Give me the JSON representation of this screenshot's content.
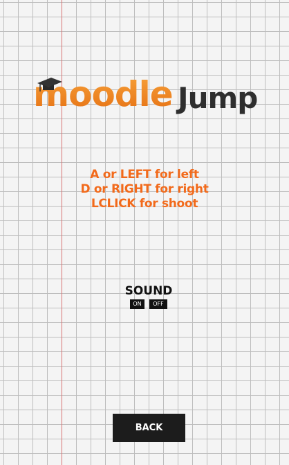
{
  "logo": {
    "moodle": "moodle",
    "jump": "Jump"
  },
  "instructions": {
    "line1": "A or LEFT for left",
    "line2": "D or RIGHT for right",
    "line3": "LCLICK for shoot"
  },
  "sound": {
    "title": "SOUND",
    "on_label": "ON",
    "off_label": "OFF"
  },
  "back_button": "BACK",
  "colors": {
    "accent": "#f26a1b",
    "ink": "#1c1c1c",
    "grid": "#bdbdbd",
    "margin_line": "#e25a5a"
  }
}
